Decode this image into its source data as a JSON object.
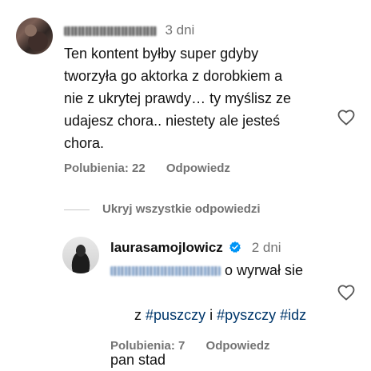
{
  "comment": {
    "time": "3 dni",
    "lines": [
      "Ten kontent byłby super gdyby",
      "tworzyła go aktorka z dorobkiem a",
      "nie z ukrytej prawdy… ty myślisz ze",
      "udajesz chora.. niestety ale jesteś",
      "chora."
    ],
    "likes_label": "Polubienia: 22",
    "reply_label": "Odpowiedz",
    "like_icon": "heart-outline-icon"
  },
  "thread": {
    "hide_replies_label": "Ukryj wszystkie odpowiedzi"
  },
  "reply": {
    "username": "laurasamojlowicz",
    "verified_icon": "verified-badge-icon",
    "verified_color": "#0095f6",
    "time": "2 dni",
    "line1_after_mention": "o wyrwał sie",
    "line2_prefix": "z ",
    "hashtag1": "#puszczy",
    "line2_mid": " i ",
    "hashtag2": "#pyszczy",
    "line2_space": " ",
    "hashtag3": "#idz",
    "line3": "pan stad",
    "likes_label": "Polubienia: 7",
    "reply_label": "Odpowiedz",
    "like_icon": "heart-outline-icon",
    "hashtag_color": "#00376b"
  }
}
